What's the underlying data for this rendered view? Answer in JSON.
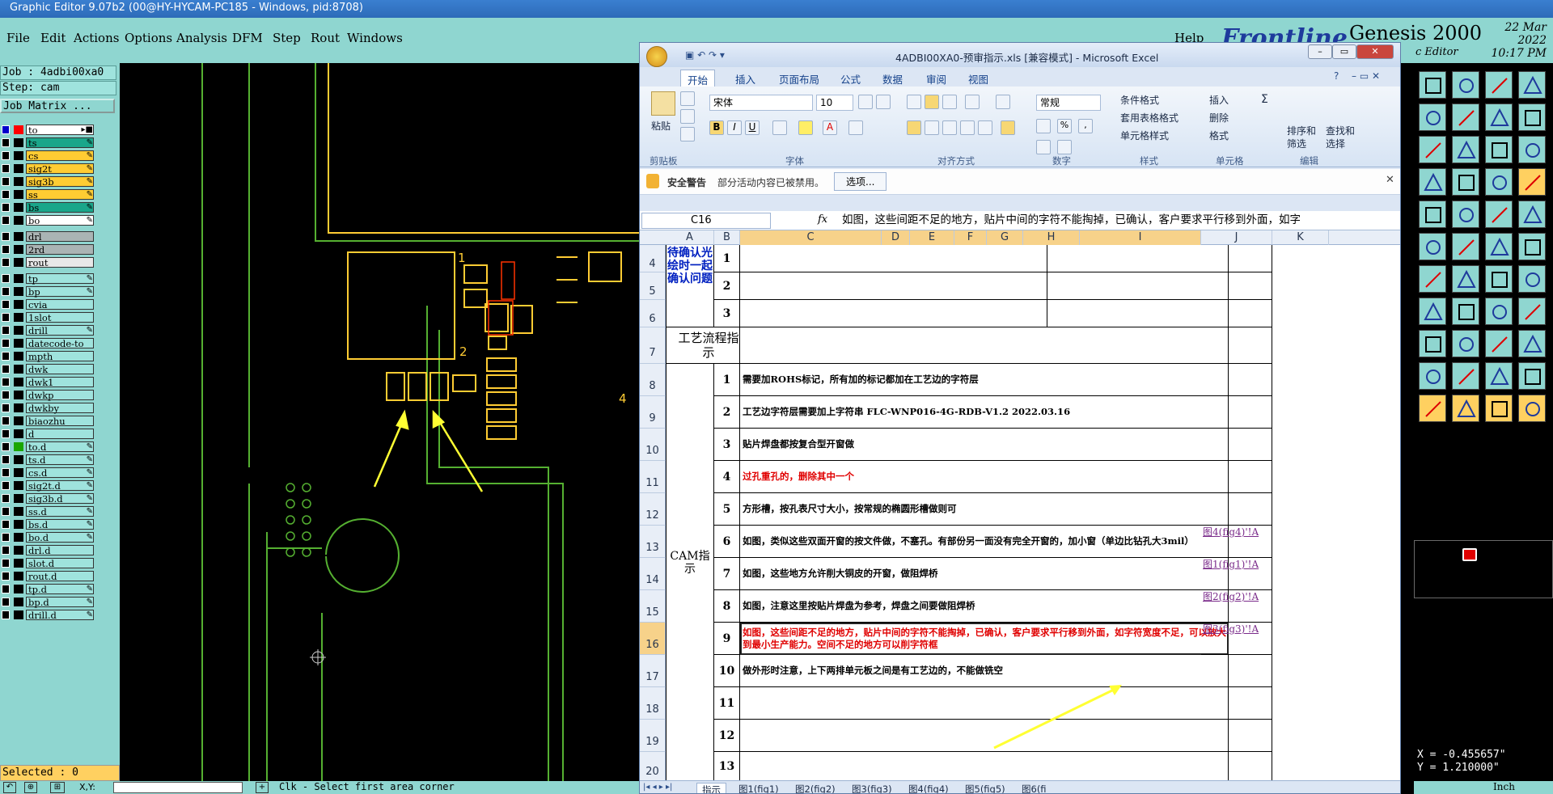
{
  "genesis": {
    "title": "Graphic Editor 9.07b2 (00@HY-HYCAM-PC185 - Windows, pid:8708)",
    "menu": [
      "File",
      "Edit",
      "Actions",
      "Options",
      "Analysis",
      "DFM",
      "Step",
      "Rout",
      "Windows"
    ],
    "help": "Help",
    "brand": "Frontline",
    "product": "Genesis 2000",
    "date": "22 Mar 2022",
    "time": "10:17 PM",
    "sub_title": "c Editor",
    "job": "Job : 4adbi00xa0",
    "step": "Step: cam",
    "job_matrix": "Job Matrix ...",
    "layers": [
      {
        "name": "to",
        "color": "#ffffff",
        "mark": "▸■"
      },
      {
        "name": "ts",
        "color": "#1aa68a",
        "mark": "✎"
      },
      {
        "name": "cs",
        "color": "#ffcc33",
        "mark": "✎"
      },
      {
        "name": "sig2t",
        "color": "#ffcc33",
        "mark": "✎"
      },
      {
        "name": "sig3b",
        "color": "#ffcc33",
        "mark": "✎"
      },
      {
        "name": "ss",
        "color": "#ffcc33",
        "mark": "✎"
      },
      {
        "name": "bs",
        "color": "#1aa68a",
        "mark": "✎"
      },
      {
        "name": "bo",
        "color": "#ffffff",
        "mark": "✎"
      },
      {
        "name": "drl",
        "color": "#aab4b4",
        "mark": ""
      },
      {
        "name": "2rd",
        "color": "#aab4b4",
        "mark": ""
      },
      {
        "name": "rout",
        "color": "#e8e8e8",
        "mark": ""
      },
      {
        "name": "tp",
        "color": "#9fe3dd",
        "mark": "✎"
      },
      {
        "name": "bp",
        "color": "#9fe3dd",
        "mark": "✎"
      },
      {
        "name": "cvia",
        "color": "#9fe3dd",
        "mark": ""
      },
      {
        "name": "1slot",
        "color": "#9fe3dd",
        "mark": ""
      },
      {
        "name": "drill",
        "color": "#9fe3dd",
        "mark": "✎"
      },
      {
        "name": "datecode-to",
        "color": "#9fe3dd",
        "mark": ""
      },
      {
        "name": "mpth",
        "color": "#9fe3dd",
        "mark": ""
      },
      {
        "name": "dwk",
        "color": "#9fe3dd",
        "mark": ""
      },
      {
        "name": "dwk1",
        "color": "#9fe3dd",
        "mark": ""
      },
      {
        "name": "dwkp",
        "color": "#9fe3dd",
        "mark": ""
      },
      {
        "name": "dwkby",
        "color": "#9fe3dd",
        "mark": ""
      },
      {
        "name": "biaozhu",
        "color": "#9fe3dd",
        "mark": ""
      },
      {
        "name": "d",
        "color": "#9fe3dd",
        "mark": ""
      },
      {
        "name": "to.d",
        "color": "#9fe3dd",
        "mark": "✎"
      },
      {
        "name": "ts.d",
        "color": "#9fe3dd",
        "mark": "✎"
      },
      {
        "name": "cs.d",
        "color": "#9fe3dd",
        "mark": "✎"
      },
      {
        "name": "sig2t.d",
        "color": "#9fe3dd",
        "mark": "✎"
      },
      {
        "name": "sig3b.d",
        "color": "#9fe3dd",
        "mark": "✎"
      },
      {
        "name": "ss.d",
        "color": "#9fe3dd",
        "mark": "✎"
      },
      {
        "name": "bs.d",
        "color": "#9fe3dd",
        "mark": "✎"
      },
      {
        "name": "bo.d",
        "color": "#9fe3dd",
        "mark": "✎"
      },
      {
        "name": "drl.d",
        "color": "#9fe3dd",
        "mark": ""
      },
      {
        "name": "slot.d",
        "color": "#9fe3dd",
        "mark": ""
      },
      {
        "name": "rout.d",
        "color": "#9fe3dd",
        "mark": ""
      },
      {
        "name": "tp.d",
        "color": "#9fe3dd",
        "mark": "✎"
      },
      {
        "name": "bp.d",
        "color": "#9fe3dd",
        "mark": "✎"
      },
      {
        "name": "drill.d",
        "color": "#9fe3dd",
        "mark": "✎"
      }
    ],
    "selected": "Selected : 0",
    "xy_label": "X,Y:",
    "status": "Clk - Select first area corner",
    "coord_x": "X = -0.455657\"",
    "coord_y": "Y = 1.210000\"",
    "unit": "Inch",
    "canvas_labels": [
      "1",
      "2",
      "4",
      "4"
    ]
  },
  "excel": {
    "title": "4ADBI00XA0-预审指示.xls [兼容模式] - Microsoft Excel",
    "tabs": [
      "开始",
      "插入",
      "页面布局",
      "公式",
      "数据",
      "审阅",
      "视图"
    ],
    "groups": [
      "剪贴板",
      "字体",
      "对齐方式",
      "数字",
      "样式",
      "单元格",
      "编辑"
    ],
    "paste": "粘贴",
    "font_name": "宋体",
    "font_size": "10",
    "number_format": "常规",
    "style_items": [
      "条件格式",
      "套用表格格式",
      "单元格样式"
    ],
    "cell_items": [
      "插入",
      "删除",
      "格式"
    ],
    "edit_items": [
      "排序和",
      "筛选",
      "查找和",
      "选择"
    ],
    "security_title": "安全警告",
    "security_msg": "部分活动内容已被禁用。",
    "security_btn": "选项...",
    "name_box": "C16",
    "fx": "fx",
    "formula": "如图，这些间距不足的地方，贴片中间的字符不能掏掉，已确认，客户要求平行移到外面，如字",
    "columns": [
      "A",
      "B",
      "C",
      "D",
      "E",
      "F",
      "G",
      "H",
      "I",
      "J",
      "K"
    ],
    "rows": [
      "4",
      "5",
      "6",
      "7",
      "8",
      "9",
      "10",
      "11",
      "12",
      "13",
      "14",
      "15",
      "16",
      "17",
      "18",
      "19",
      "20"
    ],
    "section_pending": "待确认光绘时一起确认问题",
    "section_process": "工艺流程指示",
    "section_cam": "CAM指示",
    "pending_nums": [
      "1",
      "2",
      "3"
    ],
    "items": [
      {
        "n": "1",
        "text": "需要加ROHS标记，所有加的标记都加在工艺边的字符层",
        "red": false,
        "link": ""
      },
      {
        "n": "2",
        "text": "工艺边字符层需要加上字符串  FLC-WNP016-4G-RDB-V1.2 2022.03.16",
        "red": false,
        "link": ""
      },
      {
        "n": "3",
        "text": "贴片焊盘都按复合型开窗做",
        "red": false,
        "link": ""
      },
      {
        "n": "4",
        "text": "过孔重孔的，删除其中一个",
        "red": true,
        "link": ""
      },
      {
        "n": "5",
        "text": "方形槽，按孔表尺寸大小，按常规的椭圆形槽做则可",
        "red": false,
        "link": ""
      },
      {
        "n": "6",
        "text": "如图，类似这些双面开窗的按文件做，不塞孔。有部份另一面没有完全开窗的，加小窗（单边比钻孔大3mil）",
        "red": false,
        "link": "图4(fig4)'!A"
      },
      {
        "n": "7",
        "text": "如图，这些地方允许削大铜皮的开窗，做阻焊桥",
        "red": false,
        "link": "图1(fig1)'!A"
      },
      {
        "n": "8",
        "text": "如图，注意这里按贴片焊盘为参考，焊盘之间要做阻焊桥",
        "red": false,
        "link": "图2(fig2)'!A"
      },
      {
        "n": "9",
        "text": "如图，这些间距不足的地方，贴片中间的字符不能掏掉，已确认，客户要求平行移到外面，如字符宽度不足，可以放大到最小生产能力。空间不足的地方可以削字符框",
        "red": true,
        "link": "图3(fig3)'!A"
      },
      {
        "n": "10",
        "text": "做外形时注意，上下两排单元板之间是有工艺边的，不能做铣空",
        "red": false,
        "link": ""
      },
      {
        "n": "11",
        "text": "",
        "red": false,
        "link": ""
      },
      {
        "n": "12",
        "text": "",
        "red": false,
        "link": ""
      },
      {
        "n": "13",
        "text": "",
        "red": false,
        "link": ""
      }
    ],
    "sheets": [
      "指示",
      "图1(fig1)",
      "图2(fig2)",
      "图3(fig3)",
      "图4(fig4)",
      "图5(fig5)",
      "图6(fi"
    ]
  },
  "colors": {
    "genesis_bg": "#8fd6d0",
    "canvas": "#000000",
    "pad": "#ffcc33",
    "route": "#55b031",
    "arrow": "#ffff33",
    "excel_red": "#e00000"
  }
}
